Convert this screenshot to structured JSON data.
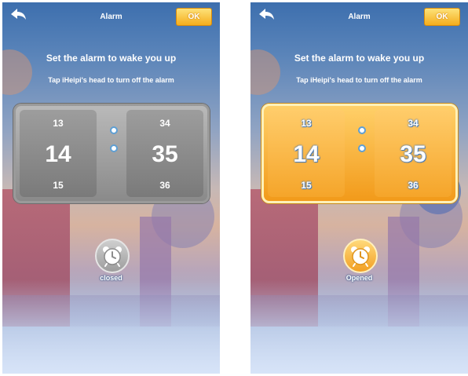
{
  "screens": [
    {
      "state": "closed",
      "header": {
        "title": "Alarm",
        "ok_label": "OK"
      },
      "heading": "Set the alarm to wake you up",
      "subheading": "Tap iHeipi's head to turn off the alarm",
      "hours": {
        "prev": "13",
        "current": "14",
        "next": "15"
      },
      "minutes": {
        "prev": "34",
        "current": "35",
        "next": "36"
      },
      "toggle": {
        "label": "closed",
        "icon": "alarm-clock-icon"
      }
    },
    {
      "state": "opened",
      "header": {
        "title": "Alarm",
        "ok_label": "OK"
      },
      "heading": "Set the alarm to wake you up",
      "subheading": "Tap iHeipi's head to turn off the alarm",
      "hours": {
        "prev": "13",
        "current": "14",
        "next": "15"
      },
      "minutes": {
        "prev": "34",
        "current": "35",
        "next": "36"
      },
      "toggle": {
        "label": "Opened",
        "icon": "alarm-clock-icon"
      }
    }
  ],
  "colors": {
    "accent_gold": "#f5ad1c",
    "off_gray": "#8a8a8a",
    "sky_blue": "#3d6fae"
  }
}
